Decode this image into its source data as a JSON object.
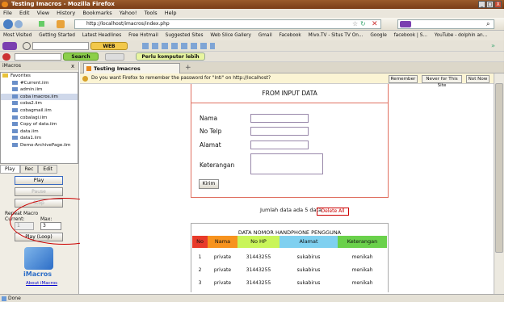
{
  "window": {
    "title": "Testing Imacros - Mozilla Firefox",
    "min": "_",
    "max": "□",
    "close": "X"
  },
  "menu": [
    "File",
    "Edit",
    "View",
    "History",
    "Bookmarks",
    "Yahoo!",
    "Tools",
    "Help"
  ],
  "nav": {
    "url": "http://localhost/imacros/index.php",
    "search_placeholder": ""
  },
  "bookmarks": [
    "Most Visited",
    "Getting Started",
    "Latest Headlines",
    "Free Hotmail",
    "Suggested Sites",
    "Web Slice Gallery",
    "Gmail",
    "Facebook",
    "Mivo.TV - Situs TV On...",
    "Google",
    "facebook | S...",
    "YouTube - dolphin an..."
  ],
  "toolbar1": {
    "web_search": "WEB SEARCH"
  },
  "toolbar2": {
    "search": "Search",
    "promo": "Perlu komputer lebih cepat?"
  },
  "sidebar": {
    "header": "iMacros",
    "tree": [
      "Favorites",
      "#Current.iim",
      "admin.iim",
      "coba imacros.iim",
      "coba2.iim",
      "cobagmail.iim",
      "cobalagi.iim",
      "Copy of data.iim",
      "data.iim",
      "data1.iim",
      "Demo-ArchivePage.iim"
    ],
    "tabs": [
      "Play",
      "Rec",
      "Edit"
    ],
    "play": "Play",
    "pause": "Pause",
    "stop": "Stop",
    "repeat_label": "Repeat Macro",
    "current_label": "Current:",
    "max_label": "Max:",
    "current_value": "1",
    "max_value": "3",
    "play_loop": "Play (Loop)",
    "logo_text": "iMacros",
    "about": "About iMacros"
  },
  "tab": {
    "label": "Testing Imacros",
    "new_tab": "+"
  },
  "password_bar": {
    "message": "Do you want Firefox to remember the password for \"lnti\" on http://localhost?",
    "remember": "Remember",
    "never": "Never for This Site",
    "not_now": "Not Now"
  },
  "form": {
    "title": "FROM INPUT DATA",
    "nama": "Nama",
    "telp": "No Telp",
    "alamat": "Alamat",
    "keterangan": "Keterangan",
    "submit": "Kirim"
  },
  "summary": {
    "text": "Jumlah data ada 5 data",
    "delete": "Delete All"
  },
  "table": {
    "title": "DATA NOMOR HANDPHONE PENGGUNA",
    "headers": [
      "No",
      "Nama",
      "No HP",
      "Alamat",
      "Keterangan"
    ],
    "rows": [
      [
        "1",
        "private",
        "31443255",
        "sukabirus",
        "menikah"
      ],
      [
        "2",
        "private",
        "31443255",
        "sukabirus",
        "menikah"
      ],
      [
        "3",
        "private",
        "31443255",
        "sukabirus",
        "menikah"
      ]
    ]
  },
  "status": {
    "text": "Done"
  },
  "colors": {
    "th_no": "#e83a2a",
    "th_nama": "#f7931e",
    "th_hp": "#c9f55a",
    "th_alamat": "#7fd0f0",
    "th_ket": "#6ad14b",
    "accent": "#e07060"
  }
}
